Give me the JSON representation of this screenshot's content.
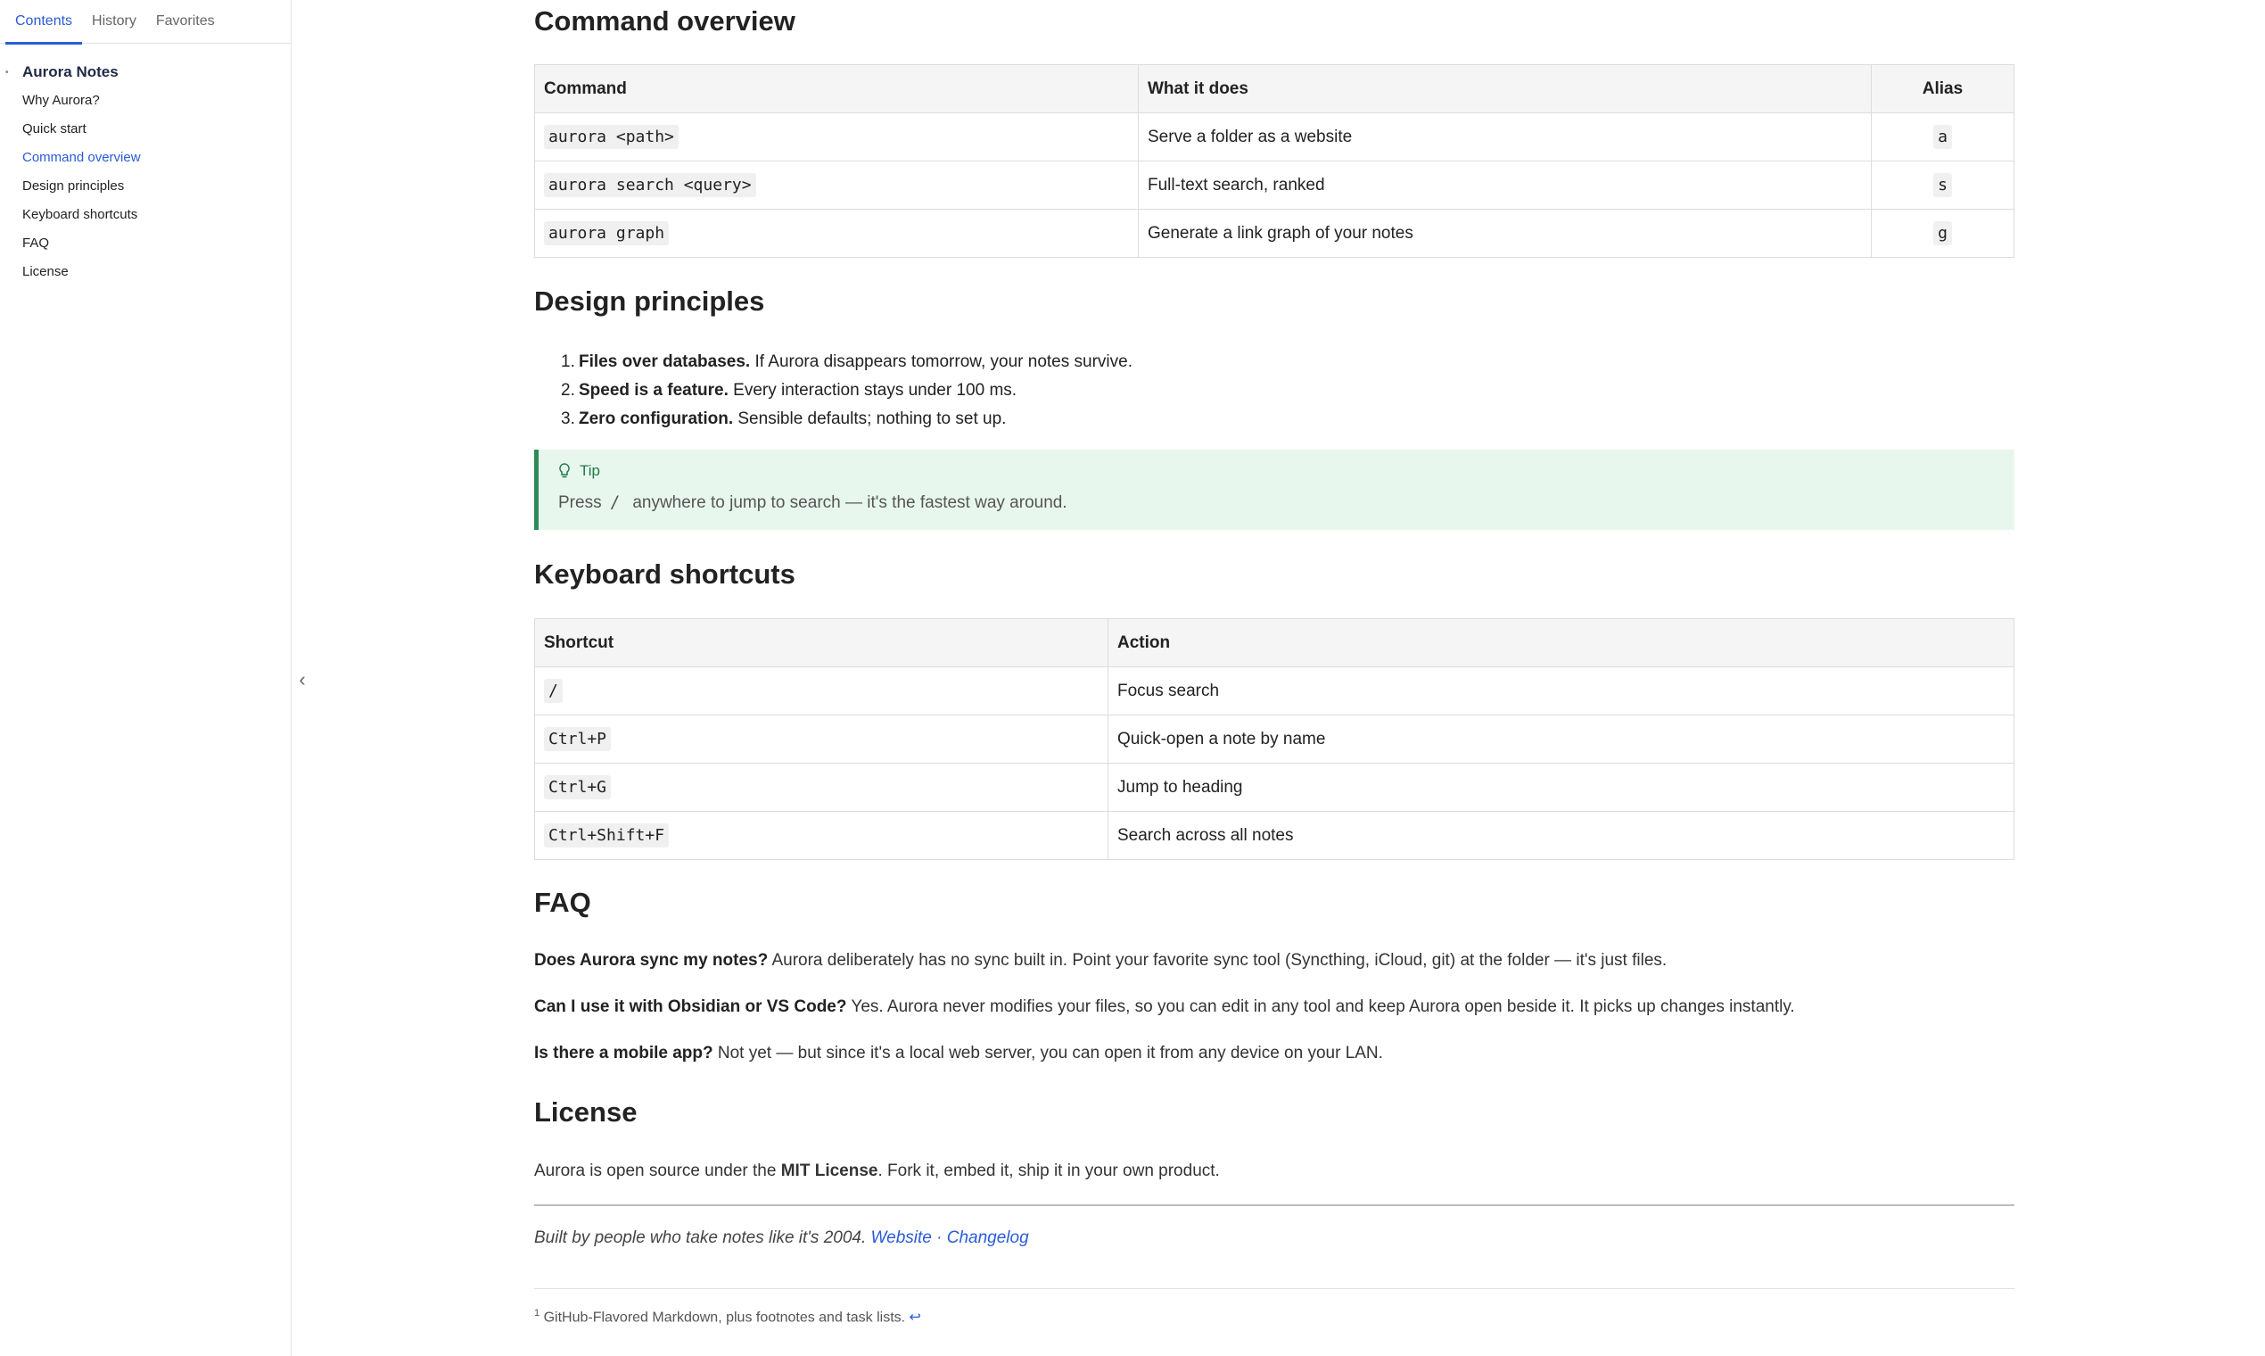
{
  "sidebar": {
    "tabs": [
      "Contents",
      "History",
      "Favorites"
    ],
    "root": "Aurora Notes",
    "items": [
      "Why Aurora?",
      "Quick start",
      "Command overview",
      "Design principles",
      "Keyboard shortcuts",
      "FAQ",
      "License"
    ],
    "active_item": "Command overview"
  },
  "sections": {
    "command_overview": "Command overview",
    "design_principles": "Design principles",
    "keyboard_shortcuts": "Keyboard shortcuts",
    "faq": "FAQ",
    "license": "License"
  },
  "command_table": {
    "headers": [
      "Command",
      "What it does",
      "Alias"
    ],
    "rows": [
      [
        "aurora <path>",
        "Serve a folder as a website",
        "a"
      ],
      [
        "aurora search <query>",
        "Full-text search, ranked",
        "s"
      ],
      [
        "aurora graph",
        "Generate a link graph of your notes",
        "g"
      ]
    ]
  },
  "principles": [
    {
      "num": "1.",
      "bold": "Files over databases.",
      "text": " If Aurora disappears tomorrow, your notes survive."
    },
    {
      "num": "2.",
      "bold": "Speed is a feature.",
      "text": " Every interaction stays under 100 ms."
    },
    {
      "num": "3.",
      "bold": "Zero configuration.",
      "text": " Sensible defaults; nothing to set up."
    }
  ],
  "tip": {
    "title": "Tip",
    "prefix": "Press",
    "key": "/",
    "suffix": "anywhere to jump to search — it's the fastest way around."
  },
  "shortcut_table": {
    "headers": [
      "Shortcut",
      "Action"
    ],
    "rows": [
      [
        "/",
        "Focus search"
      ],
      [
        "Ctrl+P",
        "Quick-open a note by name"
      ],
      [
        "Ctrl+G",
        "Jump to heading"
      ],
      [
        "Ctrl+Shift+F",
        "Search across all notes"
      ]
    ]
  },
  "faq": [
    {
      "q": "Does Aurora sync my notes?",
      "a": " Aurora deliberately has no sync built in. Point your favorite sync tool (Syncthing, iCloud, git) at the folder — it's just files."
    },
    {
      "q": "Can I use it with Obsidian or VS Code?",
      "a": " Yes. Aurora never modifies your files, so you can edit in any tool and keep Aurora open beside it. It picks up changes instantly."
    },
    {
      "q": "Is there a mobile app?",
      "a": " Not yet — but since it's a local web server, you can open it from any device on your LAN."
    }
  ],
  "license": {
    "before": "Aurora is open source under the ",
    "bold": "MIT License",
    "after": ". Fork it, embed it, ship it in your own product."
  },
  "footer": {
    "built_text": "Built by people who take notes like it's 2004. ",
    "website_link": "Website",
    "separator": " · ",
    "changelog_link": "Changelog"
  },
  "footnote": {
    "marker": "1",
    "text": " GitHub-Flavored Markdown, plus footnotes and task lists. ",
    "back_symbol": "↩"
  },
  "colors": {
    "accent": "#2a5bd7",
    "tip_bg": "#e8f7ee",
    "tip_border": "#2e8b57"
  }
}
